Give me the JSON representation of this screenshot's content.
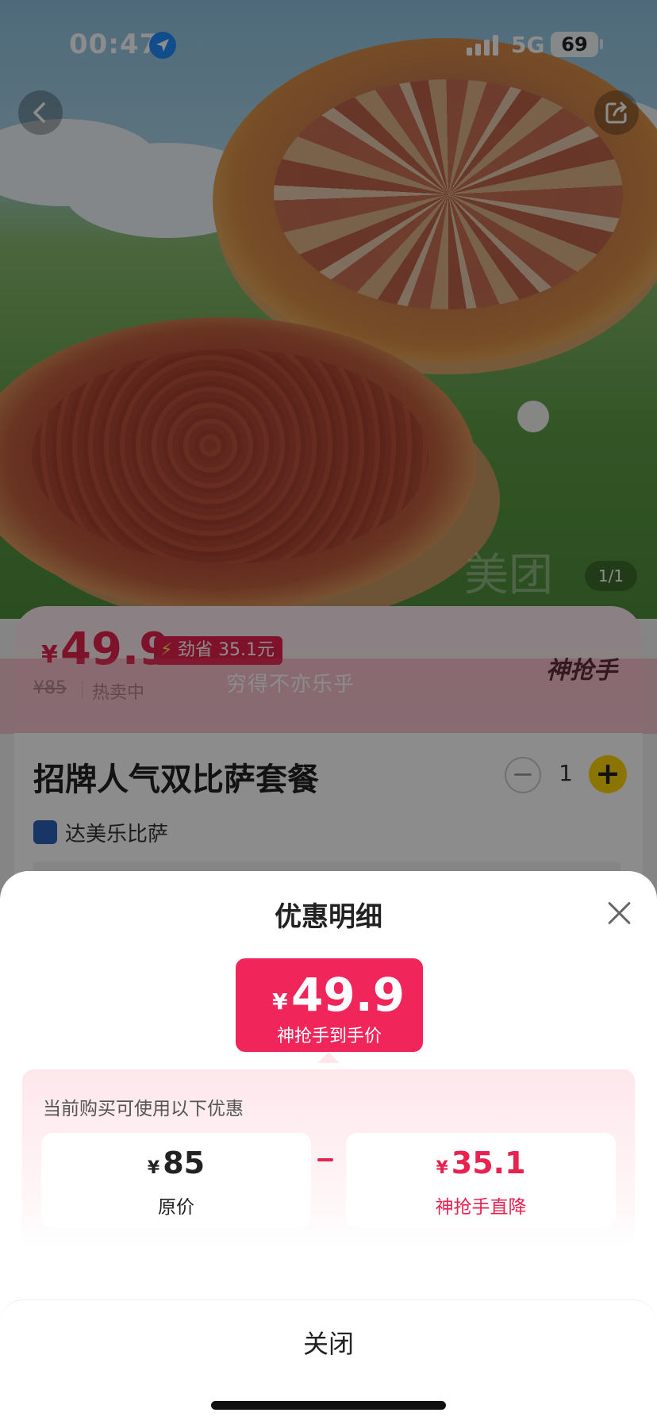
{
  "status_bar": {
    "time": "00:47",
    "network": "5G",
    "battery": "69"
  },
  "product": {
    "image_counter": "1/1",
    "watermark": "美团",
    "currency": "¥",
    "price": "49.9",
    "save_tag": "劲省 35.1元",
    "original_price": "¥85",
    "hot_label": "热卖中",
    "brand_logo": "神抢手",
    "title": "招牌人气双比萨套餐",
    "quantity": "1",
    "store_name": "达美乐比萨"
  },
  "toast": "穷得不亦乐乎",
  "sheet": {
    "title": "优惠明细",
    "final_price": {
      "currency": "¥",
      "value": "49.9",
      "label": "神抢手到手价"
    },
    "panel_note": "当前购买可使用以下优惠",
    "original": {
      "currency": "¥",
      "value": "85",
      "label": "原价"
    },
    "discount": {
      "currency": "¥",
      "value": "35.1",
      "label": "神抢手直降"
    },
    "close_label": "关闭"
  },
  "colors": {
    "accent": "#e8224f",
    "final_box": "#f0265a",
    "qty_plus": "#ffd400"
  }
}
